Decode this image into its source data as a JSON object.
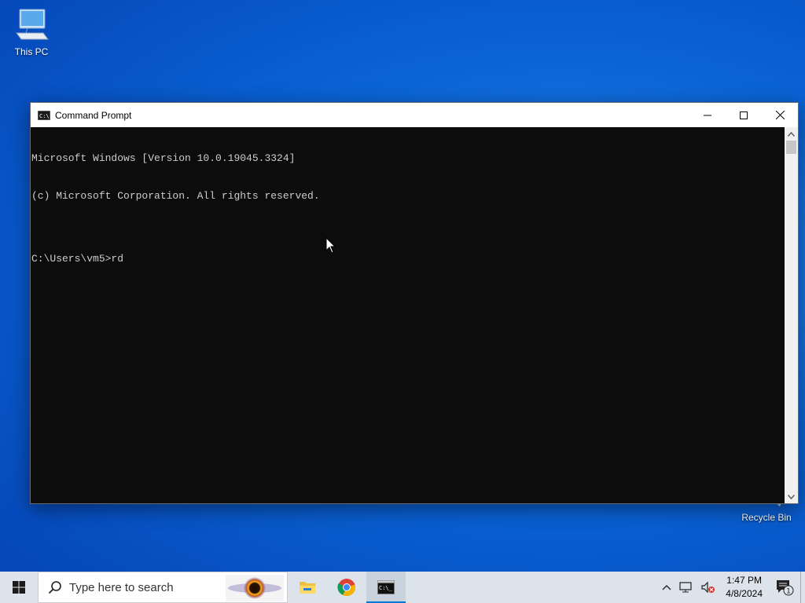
{
  "desktop": {
    "icons": [
      {
        "label": "This PC"
      },
      {
        "label": "Recycle Bin"
      }
    ]
  },
  "window": {
    "title": "Command Prompt",
    "console_lines": [
      "Microsoft Windows [Version 10.0.19045.3324]",
      "(c) Microsoft Corporation. All rights reserved.",
      "",
      "C:\\Users\\vm5>rd"
    ]
  },
  "taskbar": {
    "search_placeholder": "Type here to search",
    "apps": [
      {
        "name": "file-explorer"
      },
      {
        "name": "google-chrome"
      },
      {
        "name": "command-prompt",
        "active": true
      }
    ],
    "clock": {
      "time": "1:47 PM",
      "date": "4/8/2024"
    },
    "notification_count": "1"
  },
  "colors": {
    "console_bg": "#0c0c0c",
    "console_text": "#cccccc",
    "taskbar_bg": "#dde3ea",
    "accent": "#0078d7",
    "desktop_blue": "#0a64d6"
  }
}
